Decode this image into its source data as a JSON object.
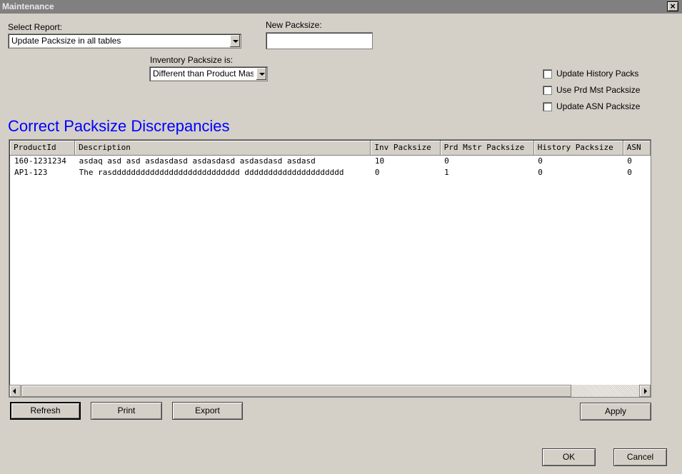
{
  "window": {
    "title": "Maintenance",
    "close_label": "×"
  },
  "select_report": {
    "label": "Select Report:",
    "value": "Update Packsize in all tables"
  },
  "new_packsize": {
    "label": "New Packsize:",
    "value": ""
  },
  "inventory_packsize": {
    "label": "Inventory Packsize is:",
    "value": "Different than Product Mas"
  },
  "options": [
    {
      "label": "Update History Packs",
      "checked": false
    },
    {
      "label": "Use Prd Mst Packsize",
      "checked": false
    },
    {
      "label": "Update ASN Packsize",
      "checked": false
    }
  ],
  "heading": "Correct Packsize Discrepancies",
  "grid": {
    "columns": [
      "ProductId",
      "Description",
      "Inv Packsize",
      "Prd Mstr Packsize",
      "History Packsize",
      "ASN"
    ],
    "rows": [
      [
        "160-1231234",
        "asdaq asd asd asdasdasd asdasdasd asdasdasd asdasd",
        "10",
        "0",
        "0",
        "0"
      ],
      [
        "AP1-123",
        "The rasddddddddddddddddddddddddddd ddddddddddddddddddddd",
        "0",
        "1",
        "0",
        "0"
      ]
    ]
  },
  "buttons": {
    "refresh": "Refresh",
    "print": "Print",
    "export": "Export",
    "apply": "Apply",
    "ok": "OK",
    "cancel": "Cancel"
  }
}
